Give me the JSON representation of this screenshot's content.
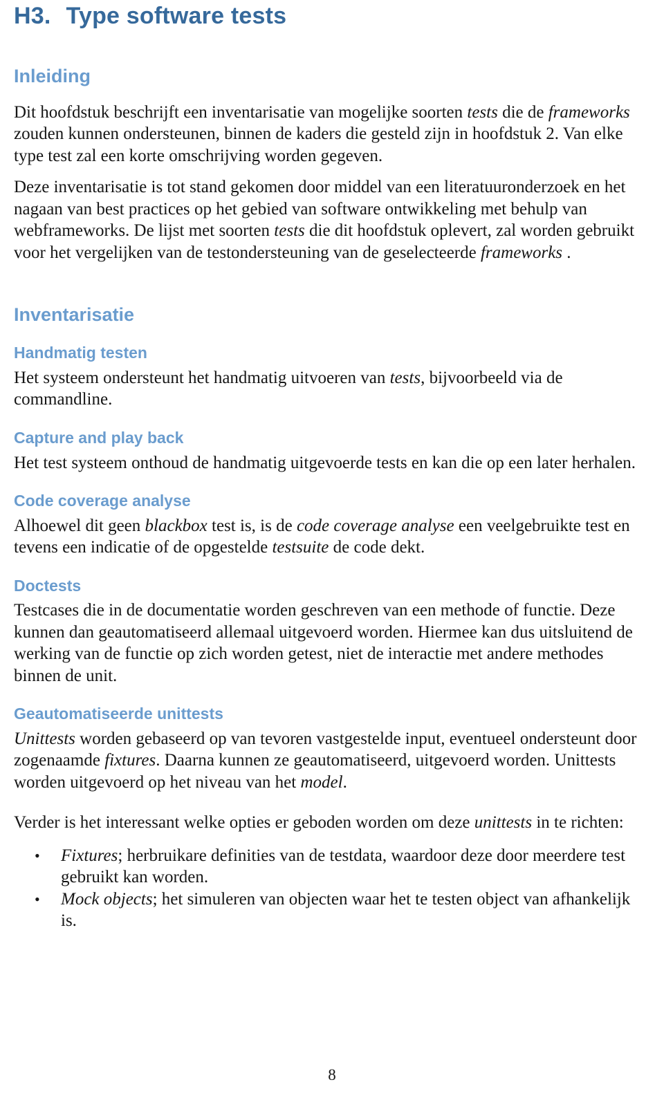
{
  "document": {
    "chapter_number": "H3.",
    "chapter_title": "Type software tests",
    "page_number": "8"
  },
  "sections": {
    "inleiding": {
      "heading": "Inleiding",
      "paragraph_1_a": "Dit hoofdstuk beschrijft een inventarisatie van mogelijke soorten ",
      "paragraph_1_it1": "tests",
      "paragraph_1_b": " die de ",
      "paragraph_1_it2": "frameworks",
      "paragraph_1_c": " zouden kunnen ondersteunen, binnen de kaders die gesteld zijn in hoofdstuk 2. Van elke  type test zal een korte omschrijving worden gegeven.",
      "paragraph_2_a": "Deze inventarisatie is tot stand gekomen door middel van een literatuuronderzoek en het nagaan van best practices op het gebied van software ontwikkeling met behulp van webframeworks. De lijst met soorten ",
      "paragraph_2_it1": "tests",
      "paragraph_2_b": " die dit hoofdstuk oplevert, zal worden gebruikt voor het vergelijken van de testondersteuning van de geselecteerde ",
      "paragraph_2_it2": "frameworks",
      "paragraph_2_c": " ."
    },
    "inventarisatie": {
      "heading": "Inventarisatie",
      "subsections": {
        "handmatig_testen": {
          "heading": "Handmatig testen",
          "body_a": "Het systeem ondersteunt het handmatig uitvoeren van ",
          "body_it1": "tests",
          "body_b": ", bijvoorbeeld via de commandline."
        },
        "capture_and_play_back": {
          "heading": "Capture and play back",
          "body_a": "Het test systeem onthoud de handmatig uitgevoerde tests en kan die op een later herhalen."
        },
        "code_coverage_analyse": {
          "heading": "Code coverage analyse",
          "body_a": "Alhoewel dit geen ",
          "body_it1": "blackbox",
          "body_b": " test is, is de ",
          "body_it2": "code coverage analyse",
          "body_c": " een veelgebruikte test en tevens een indicatie of de opgestelde ",
          "body_it3": "testsuite",
          "body_d": " de code dekt."
        },
        "doctests": {
          "heading": "Doctests",
          "body_a": "Testcases die in de documentatie worden geschreven van een methode of functie. Deze kunnen dan geautomatiseerd allemaal uitgevoerd worden. Hiermee kan dus uitsluitend de werking van de functie op zich worden getest, niet de interactie met andere methodes binnen de unit."
        },
        "geautomatiseerde_unittests": {
          "heading": "Geautomatiseerde unittests",
          "body_it1": "Unittests",
          "body_a": " worden gebaseerd op van tevoren vastgestelde input, eventueel ondersteunt door zogenaamde ",
          "body_it2": "fixtures",
          "body_b": ". Daarna kunnen ze geautomatiseerd, uitgevoerd worden. Unittests worden uitgevoerd op het niveau van het ",
          "body_it3": "model",
          "body_c": ".",
          "followup_a": "Verder is het interessant welke opties er geboden worden om deze ",
          "followup_it1": "unittests",
          "followup_b": " in te richten:",
          "bullets": [
            {
              "term": "Fixtures",
              "rest": ";  herbruikare definities van de testdata, waardoor deze door meerdere test gebruikt kan worden."
            },
            {
              "term": "Mock objects",
              "rest": "; het simuleren van objecten waar het te testen object van afhankelijk is."
            }
          ]
        }
      }
    }
  },
  "colors": {
    "chapter_title": "#36699b",
    "section_heading": "#6a9cce",
    "sub_heading": "#6a9cce",
    "body_text": "#161616",
    "background": "#ffffff"
  }
}
